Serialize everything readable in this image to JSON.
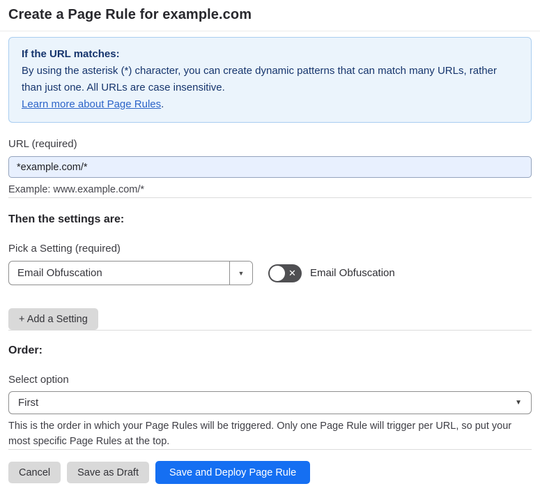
{
  "page": {
    "title": "Create a Page Rule for example.com"
  },
  "info_box": {
    "heading": "If the URL matches:",
    "body": "By using the asterisk (*) character, you can create dynamic patterns that can match many URLs, rather than just one. All URLs are case insensitive.",
    "link_label": "Learn more about Page Rules",
    "link_suffix": "."
  },
  "url_section": {
    "label": "URL (required)",
    "input_value": "*example.com/*",
    "helper": "Example: www.example.com/*"
  },
  "settings_section": {
    "heading": "Then the settings are:",
    "picker_label": "Pick a Setting (required)",
    "picker_value": "Email Obfuscation",
    "picker_arrow_icon": "▼",
    "toggle_state": "off",
    "toggle_off_glyph": "✕",
    "toggle_label": "Email Obfuscation",
    "add_setting_label": "+ Add a Setting"
  },
  "order_section": {
    "heading": "Order:",
    "select_label": "Select option",
    "select_value": "First",
    "select_arrow_icon": "▼",
    "helper": "This is the order in which your Page Rules will be triggered. Only one Page Rule will trigger per URL, so put your most specific Page Rules at the top."
  },
  "footer": {
    "cancel_label": "Cancel",
    "save_draft_label": "Save as Draft",
    "save_deploy_label": "Save and Deploy Page Rule"
  },
  "colors": {
    "info_bg": "#ebf4fc",
    "info_border": "#a9cdf0",
    "info_text": "#16356d",
    "link": "#2c64c8",
    "input_bg": "#e8f0fe",
    "primary_button": "#156ff2",
    "gray_button": "#d9d9d9",
    "toggle_off": "#4f4f52"
  }
}
